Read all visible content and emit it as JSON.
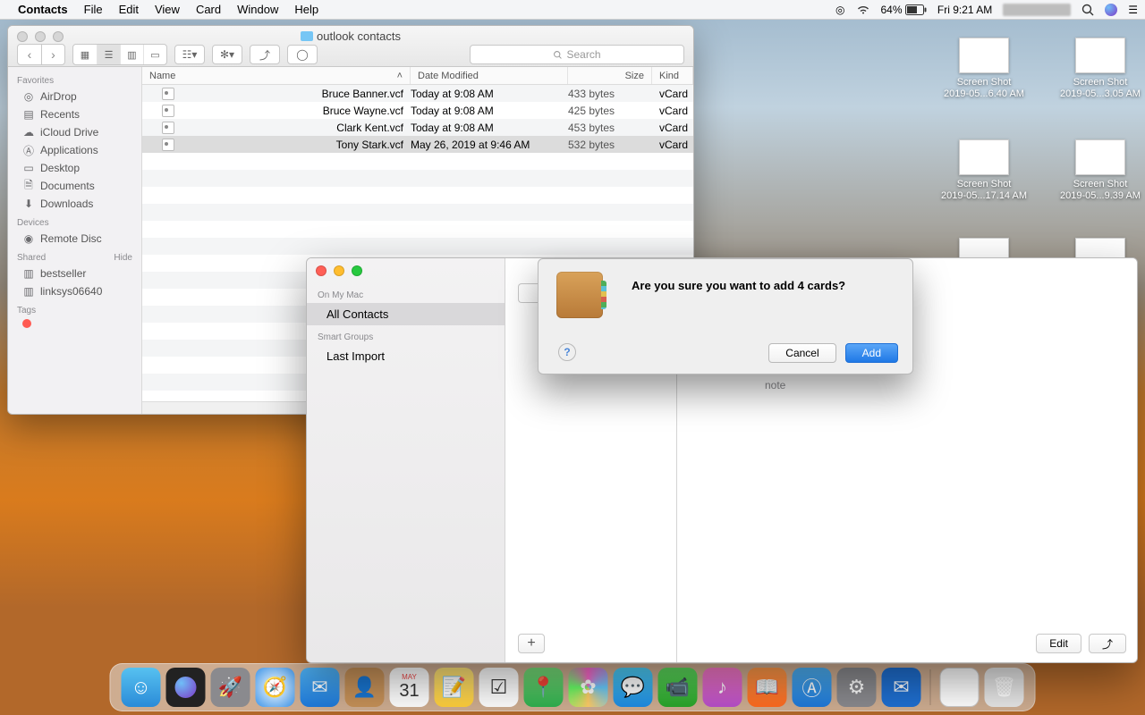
{
  "menubar": {
    "app": "Contacts",
    "items": [
      "File",
      "Edit",
      "View",
      "Card",
      "Window",
      "Help"
    ],
    "battery": "64%",
    "clock": "Fri 9:21 AM"
  },
  "desktop_icons": [
    {
      "label1": "Screen Shot",
      "label2": "2019-05...6.40 AM"
    },
    {
      "label1": "Screen Shot",
      "label2": "2019-05...3.05 AM"
    },
    {
      "label1": "Screen Shot",
      "label2": "2019-05...17.14 AM"
    },
    {
      "label1": "Screen Shot",
      "label2": "2019-05...9.39 AM"
    }
  ],
  "finder": {
    "title": "outlook contacts",
    "search_placeholder": "Search",
    "sidebar": {
      "favorites_head": "Favorites",
      "favorites": [
        "AirDrop",
        "Recents",
        "iCloud Drive",
        "Applications",
        "Desktop",
        "Documents",
        "Downloads"
      ],
      "devices_head": "Devices",
      "devices": [
        "Remote Disc"
      ],
      "shared_head": "Shared",
      "shared_hide": "Hide",
      "shared": [
        "bestseller",
        "linksys06640"
      ],
      "tags_head": "Tags",
      "tag_red": "Red"
    },
    "columns": {
      "name": "Name",
      "date": "Date Modified",
      "size": "Size",
      "kind": "Kind"
    },
    "rows": [
      {
        "name": "Bruce Banner.vcf",
        "date": "Today at 9:08 AM",
        "size": "433 bytes",
        "kind": "vCard",
        "sel": false
      },
      {
        "name": "Bruce Wayne.vcf",
        "date": "Today at 9:08 AM",
        "size": "425 bytes",
        "kind": "vCard",
        "sel": false
      },
      {
        "name": "Clark Kent.vcf",
        "date": "Today at 9:08 AM",
        "size": "453 bytes",
        "kind": "vCard",
        "sel": false
      },
      {
        "name": "Tony Stark.vcf",
        "date": "May 26, 2019 at 9:46 AM",
        "size": "532 bytes",
        "kind": "vCard",
        "sel": true
      }
    ]
  },
  "contacts": {
    "sections": {
      "on_my_mac": "On My Mac",
      "all": "All Contacts",
      "smart": "Smart Groups",
      "last": "Last Import"
    },
    "note_label": "note",
    "edit": "Edit"
  },
  "dialog": {
    "title": "Are you sure you want to add 4 cards?",
    "cancel": "Cancel",
    "add": "Add"
  },
  "dock": {
    "apps": [
      "finder",
      "siri",
      "launchpad",
      "safari",
      "mail",
      "contacts",
      "calendar",
      "notes",
      "reminders",
      "maps",
      "photos",
      "messages",
      "facetime",
      "itunes",
      "books",
      "appstore",
      "preferences",
      "outlook"
    ],
    "calendar_day": "31"
  }
}
